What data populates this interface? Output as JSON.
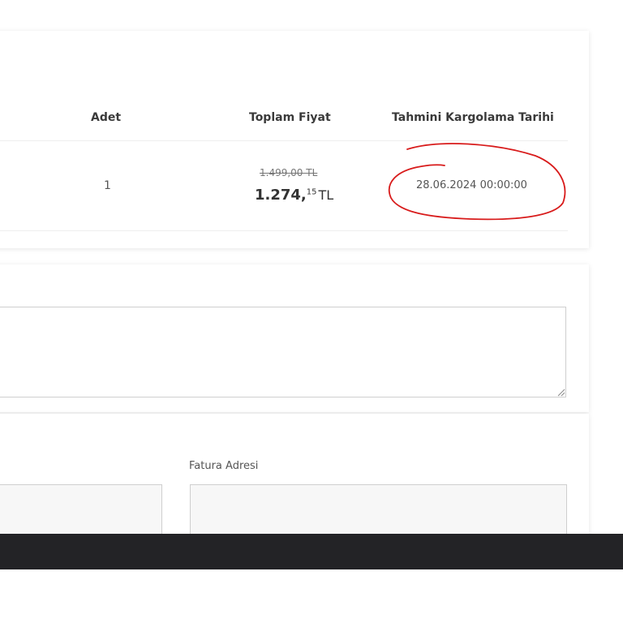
{
  "order_table": {
    "headers": {
      "quantity": "Adet",
      "total_price": "Toplam Fiyat",
      "estimated_shipping_date": "Tahmini Kargolama Tarihi"
    },
    "row": {
      "quantity": "1",
      "old_price": "1.499,00 TL",
      "new_price_main": "1.274,",
      "new_price_cents": "15",
      "currency": "TL",
      "shipping_date": "28.06.2024 00:00:00"
    }
  },
  "address": {
    "billing_label": "Fatura Adresi"
  },
  "colors": {
    "annotation_circle": "#d81b1b",
    "bottom_bar": "#232326"
  }
}
